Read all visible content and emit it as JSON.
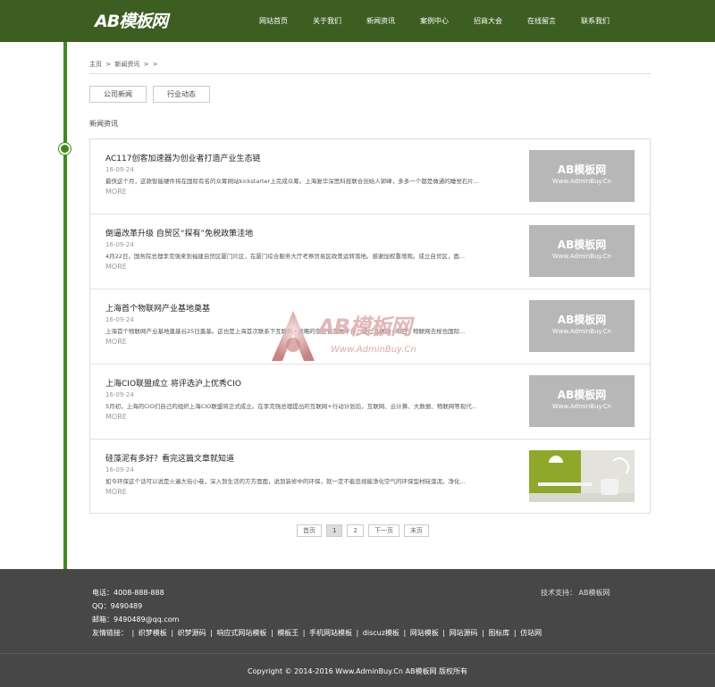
{
  "header": {
    "logo": "AB模板网",
    "nav": [
      "网站首页",
      "关于我们",
      "新闻资讯",
      "案例中心",
      "招商大会",
      "在线留言",
      "联系我们"
    ]
  },
  "breadcrumb": [
    "主页",
    ">",
    "新闻资讯",
    ">",
    ">"
  ],
  "categories": [
    "公司新闻",
    "行业动态"
  ],
  "section_title": "新闻资讯",
  "news": [
    {
      "title": "AC117创客加速器为创业者打造产业生态链",
      "date": "16-09-24",
      "desc": "最快这个月，这款智能硬件将在国际有名的众筹网站kickstarter上完成众筹。上海复华深思科技联合创始人郭峰，多多一个都是做通的睡觉石片...",
      "more": "MORE",
      "thumb_logo": "AB模板网",
      "thumb_url": "Www.AdminBuy.Cn"
    },
    {
      "title": "倒逼改革升级 自贸区“探有”免税政策洼地",
      "date": "16-09-24",
      "desc": "4月22日，国务院总理李克强来到福建自贸区厦门片区，在厦门综合服务大厅考察贸易区政策运转落地。感谢加权重增观。成立自贸区，面...",
      "more": "MORE",
      "thumb_logo": "AB模板网",
      "thumb_url": "Www.AdminBuy.Cn"
    },
    {
      "title": "上海首个物联网产业基地奠基",
      "date": "16-09-24",
      "desc": "上海首个物联网产业基地奠基谷25日奠基。这也是上海首次联系下互联网+战略的实业化落地平台，通过互联网+项目，物联网去规也国际...",
      "more": "MORE",
      "thumb_logo": "AB模板网",
      "thumb_url": "Www.AdminBuy.Cn"
    },
    {
      "title": "上海CIO联盟成立 将评选沪上优秀CIO",
      "date": "16-09-24",
      "desc": "5月初，上海的CIO们自己的组织上海CIO联盟将正式成立。在李克强总理提出的互联网+行动计划后，互联网、云计算、大数据、物联网等现代...",
      "more": "MORE",
      "thumb_logo": "AB模板网",
      "thumb_url": "Www.AdminBuy.Cn"
    },
    {
      "title": "硅藻泥有多好？看完这篇文章就知道",
      "date": "16-09-24",
      "desc": "如今环保这个话可以说是火遍大街小巷，深入到生活的方方面面，说到装修中的环保，就一定不能忽视能净化空气的环保型材硅藻泥。净化...",
      "more": "MORE"
    }
  ],
  "pager": [
    "首页",
    "1",
    "2",
    "下一页",
    "末页"
  ],
  "watermark": {
    "logo": "AB模板网",
    "url": "Www.AdminBuy.Cn"
  },
  "footer": {
    "phone": "电话：4008-888-888",
    "qq": "QQ：9490489",
    "email": "邮箱：9490489@qq.com",
    "tech": "技术支持：   AB模板网",
    "links_label": "友情链接：",
    "links": [
      "织梦模板",
      "织梦源码",
      "响应式网站模板",
      "模板王",
      "手机网站模板",
      "discuz模板",
      "网站模板",
      "网站源码",
      "图标库",
      "仿站网"
    ],
    "copyright": "Copyright © 2014-2016 Www.AdminBuy.Cn AB模板网 版权所有"
  },
  "colors": {
    "header": "#3d5e21",
    "accent": "#3d8c1a",
    "footer": "#474747"
  }
}
